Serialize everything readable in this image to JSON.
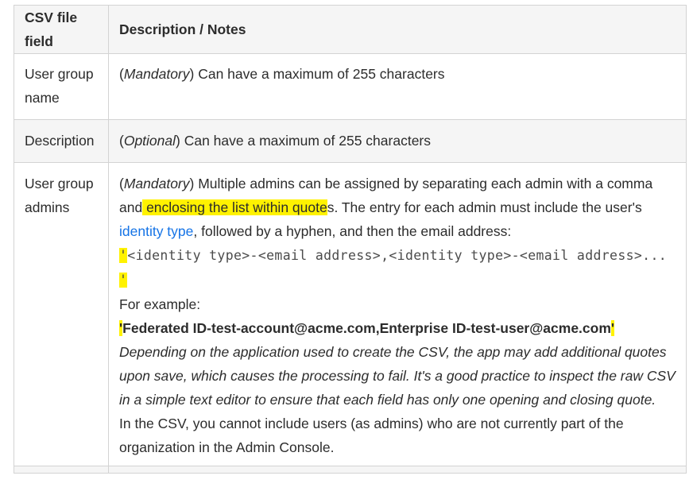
{
  "table": {
    "headers": [
      "CSV file field",
      "Description / Notes"
    ],
    "rows": [
      {
        "field": "User group name",
        "req": "Mandatory",
        "text": "Can have a maximum of 255 characters"
      },
      {
        "field": "Description",
        "req": "Optional",
        "text": "Can have a maximum of 255 characters"
      },
      {
        "field": "User group admins",
        "req": "Mandatory",
        "p1_a": "Multiple admins can be assigned by separating each admin with a comma and",
        "p1_hl": " enclosing the list within quote",
        "p1_b": "s. The entry for each admin must include the user's ",
        "p1_link": "identity type",
        "p1_c": ", followed by a hyphen, and then the email address:",
        "code_open": "'",
        "code": "<identity type>-<email address>,<identity type>-<email address>...",
        "code_close": "'",
        "example_label": "For example:",
        "example_open": "'",
        "example": "Federated ID-test-account@acme.com,Enterprise ID-test-user@acme.com",
        "example_close": "'",
        "note": "Depending on the application used to create the CSV, the app may add additional quotes upon save, which causes the processing to fail. It's a good practice to inspect the raw CSV in a simple text editor to ensure that each field has only one opening and closing quote.",
        "final": "In the CSV, you cannot include users (as admins) who are not currently part of the organization in the Admin Console."
      }
    ]
  },
  "colors": {
    "highlight": "#fff200",
    "link": "#1473e6",
    "border": "#d3d3d3",
    "header_bg": "#f5f5f5"
  }
}
